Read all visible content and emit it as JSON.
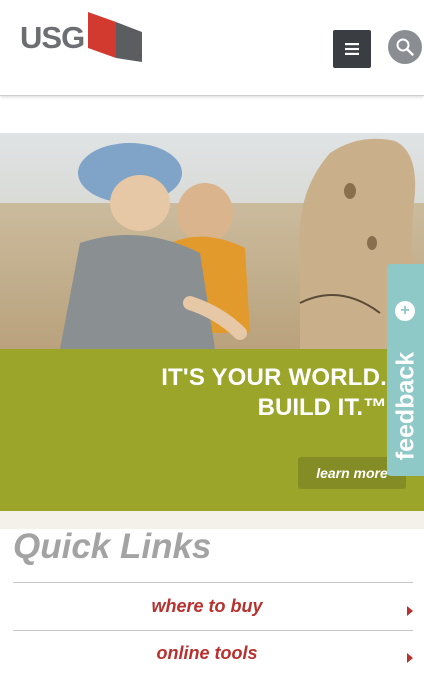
{
  "header": {
    "logo_text": "USG",
    "logo_mark": "™",
    "menu_icon": "hamburger-menu-icon",
    "search_icon": "search-icon"
  },
  "hero": {
    "headline_line1": "IT'S YOUR WORLD.",
    "headline_line2": "BUILD IT.™",
    "cta_label": "learn more"
  },
  "feedback": {
    "label": "feedback",
    "plus": "+"
  },
  "quick_links": {
    "title": "Quick Links",
    "items": [
      {
        "label": "where to buy"
      },
      {
        "label": "online tools"
      }
    ]
  },
  "colors": {
    "brand_red": "#b8312f",
    "hero_green": "#9aa52a",
    "feedback_teal": "#8ec8c7",
    "menu_dark": "#3a3d42"
  }
}
